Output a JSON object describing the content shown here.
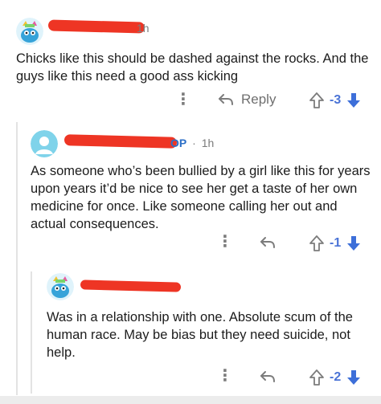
{
  "comments": [
    {
      "time": "1h",
      "body": "Chicks like this should be dashed against the rocks. And the guys like this need a good ass kicking",
      "reply_label": "Reply",
      "score": "-3"
    },
    {
      "op_label": "OP",
      "separator": "·",
      "time": "1h",
      "body": "As someone who’s been bullied by a girl like this for years upon years it’d be nice to see her get a taste of her own medicine for once. Like someone calling her out and actual consequences.",
      "score": "-1"
    },
    {
      "body": "Was in a relationship with one. Absolute scum of the human race. May be bias but they need suicide, not help.",
      "score": "-2"
    }
  ],
  "icons": {
    "more": "more-vertical-icon",
    "reply": "reply-arrow-icon",
    "upvote": "upvote-arrow-icon",
    "downvote": "downvote-arrow-icon"
  },
  "colors": {
    "redaction": "#ee3524",
    "score": "#4a73d6",
    "downvote": "#3d6fd9",
    "op": "#2c6fc7",
    "muted": "#7c7c7c"
  }
}
